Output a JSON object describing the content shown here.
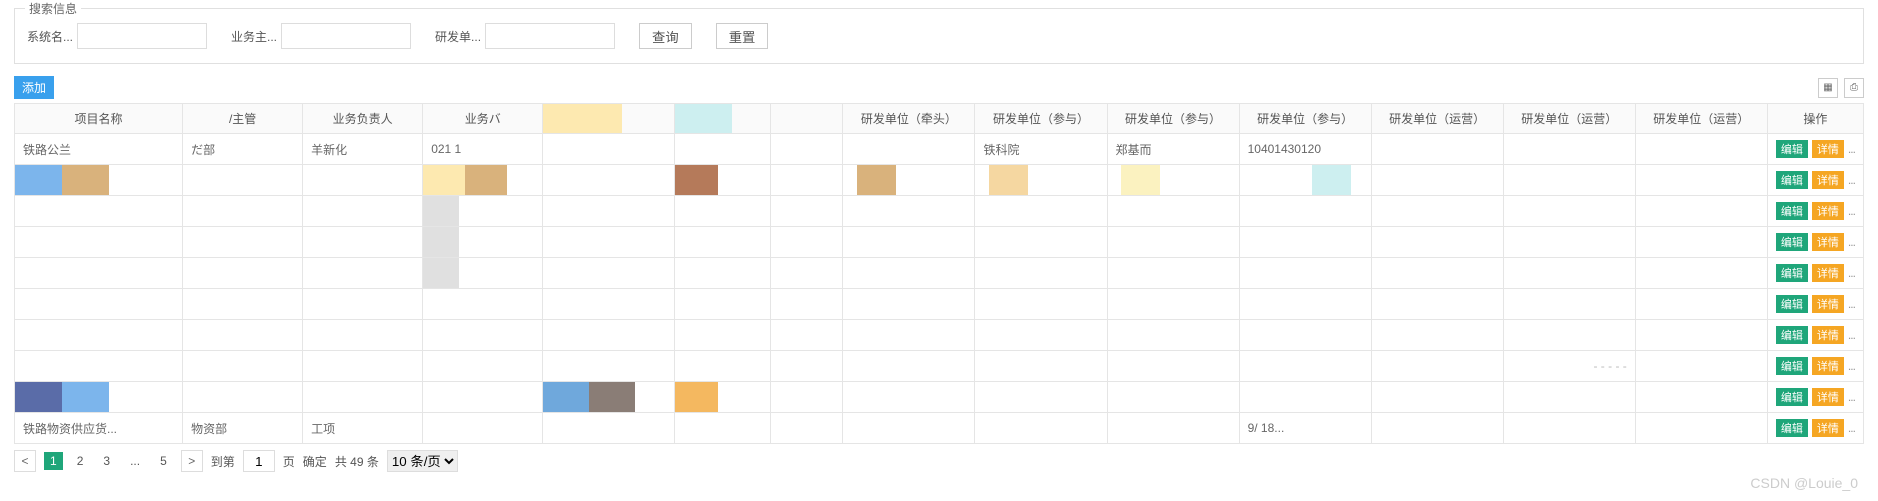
{
  "search": {
    "panel_title": "搜索信息",
    "fields": {
      "system_label": "系统名...",
      "business_label": "业务主...",
      "dev_label": "研发单..."
    },
    "query_btn": "查询",
    "reset_btn": "重置"
  },
  "toolbar": {
    "add_btn": "添加"
  },
  "table": {
    "headers": {
      "project_name": "项目名称",
      "dept_head": "/主管",
      "biz_owner": "业务负责人",
      "biz_sub": "业务バ",
      "dev_lead": "研发单位（牵头）",
      "dev_part1": "研发单位（参与）",
      "dev_part2": "研发单位（参与）",
      "dev_part3": "研发单位（参与）",
      "dev_ops1": "研发单位（运营）",
      "dev_ops2": "研发单位（运营）",
      "dev_ops3": "研发单位（运营）",
      "op_col": "操作"
    },
    "row1": {
      "c0": "铁路公兰",
      "c1": "だ部",
      "c2": "羊新化",
      "c3": "021  1",
      "c8": "铁科院",
      "c9": "郑基而",
      "c10": "10401430120"
    },
    "row_last": {
      "c0": "铁路物资供应货...",
      "c1": "物资部",
      "c2": "工项",
      "c10": "9/ 18..."
    },
    "ops": {
      "edit": "编辑",
      "detail": "详情",
      "more": "..."
    }
  },
  "pagination": {
    "pages": [
      "1",
      "2",
      "3",
      "...",
      "5"
    ],
    "goto_label": "到第",
    "page_unit": "页",
    "confirm": "确定",
    "total": "共 49 条",
    "per_page": "10 条/页"
  },
  "watermark": "CSDN @Louie_0",
  "chart_data": null
}
